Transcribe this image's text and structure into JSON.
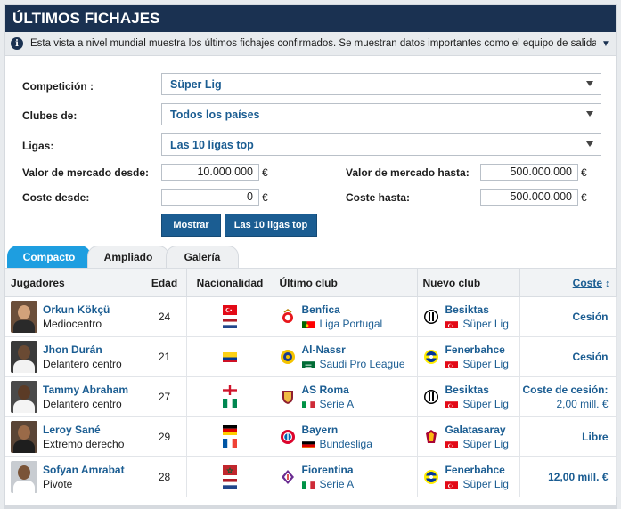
{
  "title": "ÚLTIMOS FICHAJES",
  "info": "Esta vista a nivel mundial muestra los últimos fichajes confirmados. Se muestran datos importantes como el equipo de salida y el de llegada, la c...",
  "filters": {
    "competicion_label": "Competición :",
    "competicion_value": "Süper Lig",
    "clubes_label": "Clubes de:",
    "clubes_value": "Todos los países",
    "ligas_label": "Ligas:",
    "ligas_value": "Las 10 ligas top",
    "valor_desde_label": "Valor de mercado desde:",
    "valor_desde_value": "10.000.000",
    "valor_hasta_label": "Valor de mercado hasta:",
    "valor_hasta_value": "500.000.000",
    "coste_desde_label": "Coste desde:",
    "coste_desde_value": "0",
    "coste_hasta_label": "Coste hasta:",
    "coste_hasta_value": "500.000.000",
    "currency": "€",
    "btn_mostrar": "Mostrar",
    "btn_top10": "Las 10 ligas top"
  },
  "tabs": [
    "Compacto",
    "Ampliado",
    "Galería"
  ],
  "table": {
    "headers": {
      "jugadores": "Jugadores",
      "edad": "Edad",
      "nacionalidad": "Nacionalidad",
      "ultimo": "Último club",
      "nuevo": "Nuevo club",
      "coste": "Coste",
      "sort": "↕"
    },
    "rows": [
      {
        "name": "Orkun Kökçü",
        "position": "Mediocentro",
        "age": "24",
        "nat": [
          "turkey",
          "netherlands"
        ],
        "from_club": "Benfica",
        "from_crest": "benfica-crest",
        "from_league": "Liga Portugal",
        "from_flag": "portugal",
        "to_club": "Besiktas",
        "to_crest": "besiktas-crest",
        "to_league": "Süper Lig",
        "to_flag": "turkey",
        "cost_line1": "Cesión",
        "cost_line2": ""
      },
      {
        "name": "Jhon Durán",
        "position": "Delantero centro",
        "age": "21",
        "nat": [
          "colombia"
        ],
        "from_club": "Al-Nassr",
        "from_crest": "alnassr-crest",
        "from_league": "Saudi Pro League",
        "from_flag": "saudi",
        "to_club": "Fenerbahce",
        "to_crest": "fenerbahce-crest",
        "to_league": "Süper Lig",
        "to_flag": "turkey",
        "cost_line1": "Cesión",
        "cost_line2": ""
      },
      {
        "name": "Tammy Abraham",
        "position": "Delantero centro",
        "age": "27",
        "nat": [
          "england",
          "nigeria"
        ],
        "from_club": "AS Roma",
        "from_crest": "roma-crest",
        "from_league": "Serie A",
        "from_flag": "italy",
        "to_club": "Besiktas",
        "to_crest": "besiktas-crest",
        "to_league": "Süper Lig",
        "to_flag": "turkey",
        "cost_line1": "Coste de cesión:",
        "cost_line2": "2,00 mill. €"
      },
      {
        "name": "Leroy Sané",
        "position": "Extremo derecho",
        "age": "29",
        "nat": [
          "germany",
          "france"
        ],
        "from_club": "Bayern",
        "from_crest": "bayern-crest",
        "from_league": "Bundesliga",
        "from_flag": "germany",
        "to_club": "Galatasaray",
        "to_crest": "galatasaray-crest",
        "to_league": "Süper Lig",
        "to_flag": "turkey",
        "cost_line1": "Libre",
        "cost_line2": ""
      },
      {
        "name": "Sofyan Amrabat",
        "position": "Pivote",
        "age": "28",
        "nat": [
          "morocco",
          "netherlands"
        ],
        "from_club": "Fiorentina",
        "from_crest": "fiorentina-crest",
        "from_league": "Serie A",
        "from_flag": "italy",
        "to_club": "Fenerbahce",
        "to_crest": "fenerbahce-crest",
        "to_league": "Süper Lig",
        "to_flag": "turkey",
        "cost_line1": "12,00 mill. €",
        "cost_line2": ""
      }
    ]
  },
  "colors": {
    "navy": "#1a3151",
    "link": "#1b5d92",
    "tab_active": "#1e9ee0"
  }
}
